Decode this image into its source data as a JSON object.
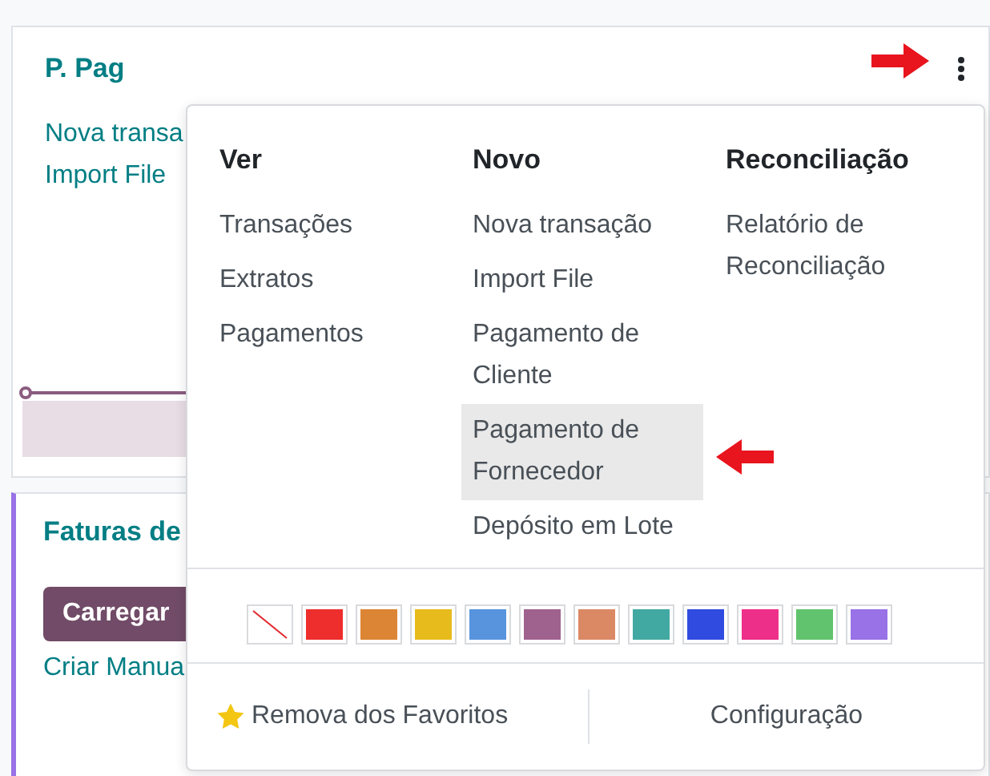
{
  "journal_card": {
    "title": "P. Pag",
    "links": [
      "Nova transa",
      "Import File"
    ]
  },
  "bills_card": {
    "title": "Faturas de",
    "upload_button": "Carregar",
    "link": "Criar Manua"
  },
  "menu": {
    "columns": [
      {
        "heading": "Ver",
        "items": [
          {
            "label": "Transações",
            "selected": false
          },
          {
            "label": "Extratos",
            "selected": false
          },
          {
            "label": "Pagamentos",
            "selected": false
          }
        ]
      },
      {
        "heading": "Novo",
        "items": [
          {
            "label": "Nova transação",
            "selected": false
          },
          {
            "label": "Import File",
            "selected": false
          },
          {
            "label": "Pagamento de Cliente",
            "selected": false
          },
          {
            "label": "Pagamento de Fornecedor",
            "selected": true
          },
          {
            "label": "Depósito em Lote",
            "selected": false
          }
        ]
      },
      {
        "heading": "Reconciliação",
        "items": [
          {
            "label": "Relatório de Reconciliação",
            "selected": false
          }
        ]
      }
    ],
    "colors": [
      {
        "kind": "none"
      },
      {
        "kind": "color",
        "color": "#ee2d2d"
      },
      {
        "kind": "color",
        "color": "#dc8534"
      },
      {
        "kind": "color",
        "color": "#e8bb1d"
      },
      {
        "kind": "color",
        "color": "#5794dd"
      },
      {
        "kind": "color",
        "color": "#9f628f"
      },
      {
        "kind": "color",
        "color": "#db8865"
      },
      {
        "kind": "color",
        "color": "#41a9a2"
      },
      {
        "kind": "color",
        "color": "#304be0"
      },
      {
        "kind": "color",
        "color": "#ee2f8a"
      },
      {
        "kind": "color",
        "color": "#61c36e"
      },
      {
        "kind": "color",
        "color": "#9872e6"
      }
    ],
    "favorite": {
      "label": "Remova dos Favoritos",
      "starred": true
    },
    "settings": "Configuração"
  }
}
